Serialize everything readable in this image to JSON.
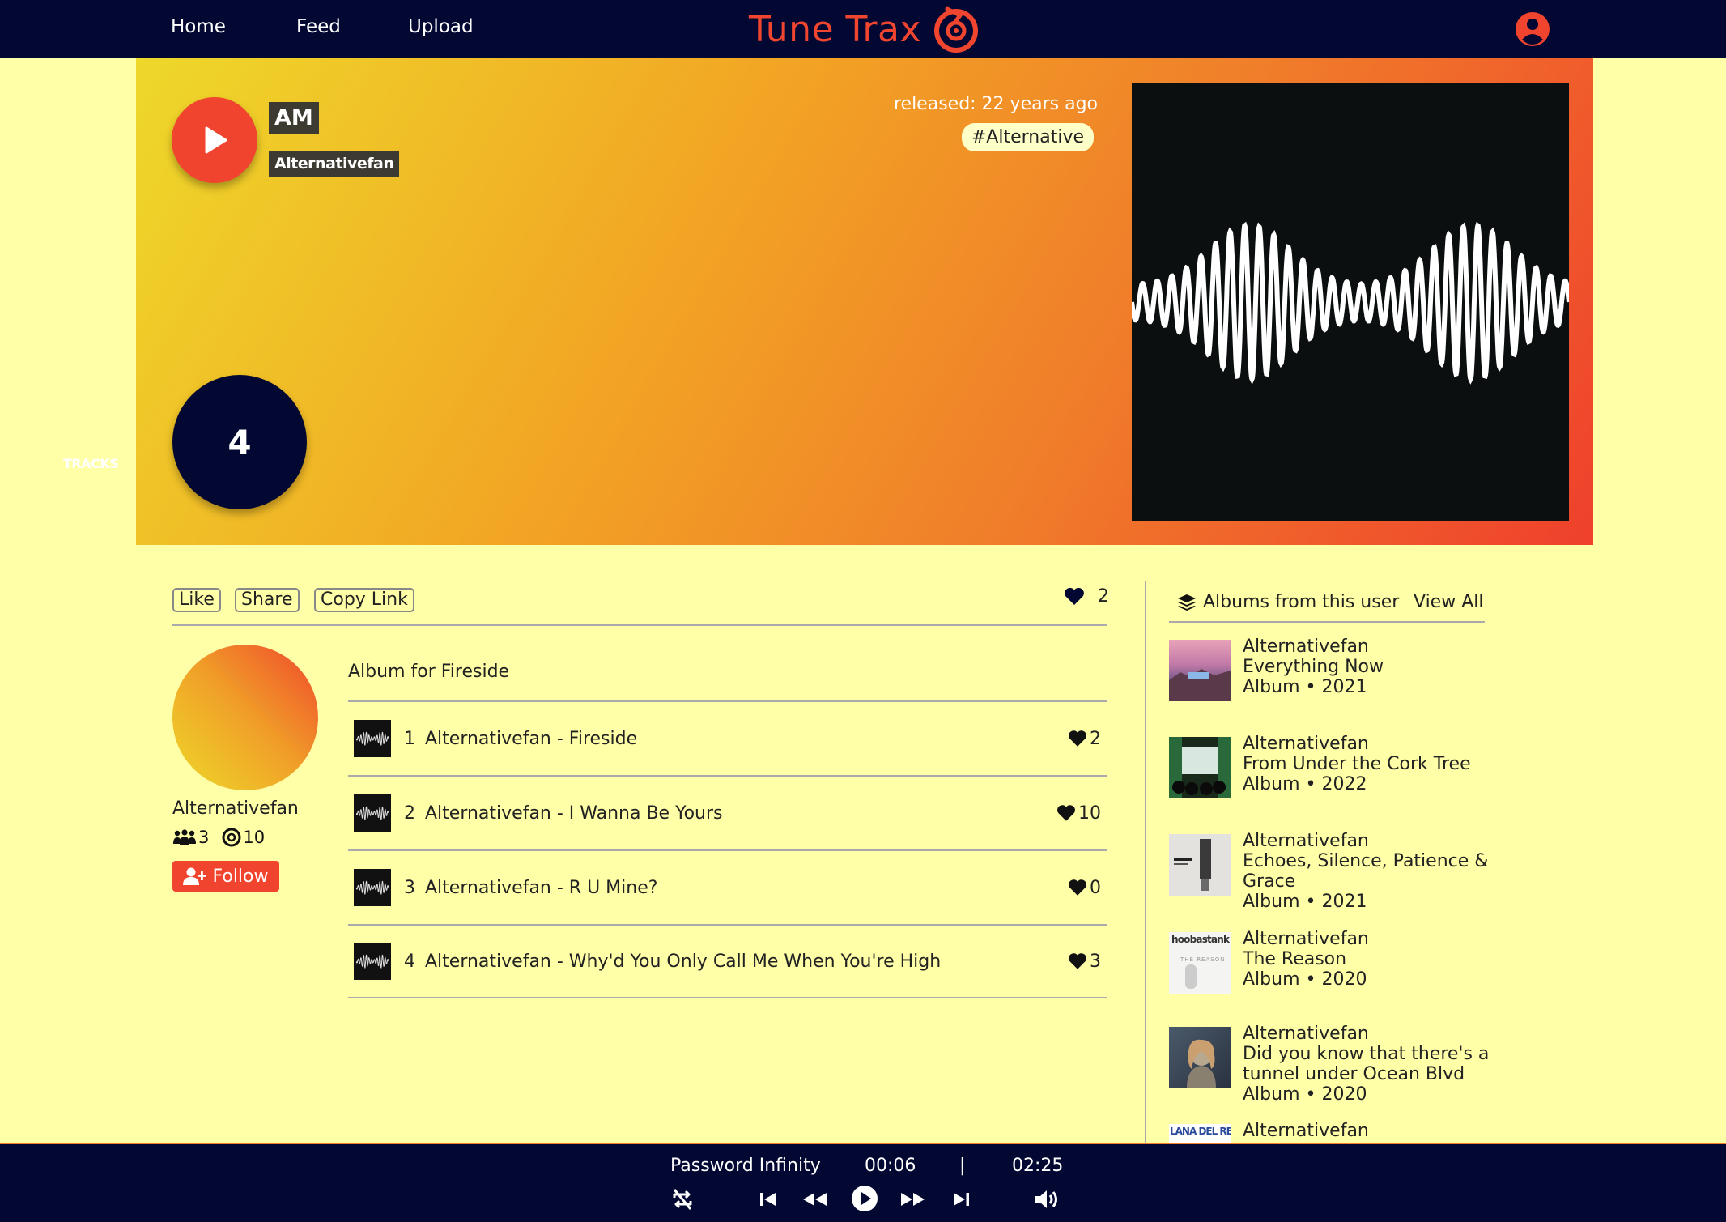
{
  "nav": {
    "links": [
      "Home",
      "Feed",
      "Upload"
    ],
    "brand": "Tune Trax"
  },
  "colors": {
    "navy": "#030833",
    "accent": "#f0442e",
    "page_bg": "#ffffa8"
  },
  "hero": {
    "title": "AM",
    "artist": "Alternativefan",
    "released": "released: 22 years ago",
    "genre": "#Alternative",
    "track_count": "4",
    "tracks_label": "TRACKS"
  },
  "actions": {
    "like": "Like",
    "share": "Share",
    "copy_link": "Copy Link",
    "like_count": "2"
  },
  "profile": {
    "name": "Alternativefan",
    "followers": "3",
    "tracks": "10",
    "follow_label": "Follow"
  },
  "album": {
    "description": "Album for Fireside",
    "tracks": [
      {
        "num": "1",
        "title": "Alternativefan - Fireside",
        "likes": "2"
      },
      {
        "num": "2",
        "title": "Alternativefan - I Wanna Be Yours",
        "likes": "10"
      },
      {
        "num": "3",
        "title": "Alternativefan - R U Mine?",
        "likes": "0"
      },
      {
        "num": "4",
        "title": "Alternativefan - Why'd You Only Call Me When You're High",
        "likes": "3"
      }
    ]
  },
  "sidebar": {
    "header": "Albums from this user",
    "view_all": "View All",
    "albums": [
      {
        "artist": "Alternativefan",
        "title": "Everything Now",
        "meta": "Album • 2021"
      },
      {
        "artist": "Alternativefan",
        "title": "From Under the Cork Tree",
        "meta": "Album • 2022"
      },
      {
        "artist": "Alternativefan",
        "title": "Echoes, Silence, Patience & Grace",
        "meta": "Album • 2021"
      },
      {
        "artist": "Alternativefan",
        "title": "The Reason",
        "meta": "Album • 2020"
      },
      {
        "artist": "Alternativefan",
        "title": "Did you know that there's a tunnel under Ocean Blvd",
        "meta": "Album • 2020"
      },
      {
        "artist": "Alternativefan",
        "title": "",
        "meta": ""
      }
    ],
    "thumb_texts": {
      "hoobastank": "hoobastank",
      "the_reason": "THE REASON",
      "lana": "LANA DEL REY"
    }
  },
  "player": {
    "track": "Password Infinity",
    "elapsed": "00:06",
    "separator": "|",
    "duration": "02:25",
    "icons": [
      "repeat-off-icon",
      "skip-back-icon",
      "rewind-icon",
      "play-icon",
      "fast-forward-icon",
      "skip-forward-icon",
      "volume-icon"
    ]
  }
}
